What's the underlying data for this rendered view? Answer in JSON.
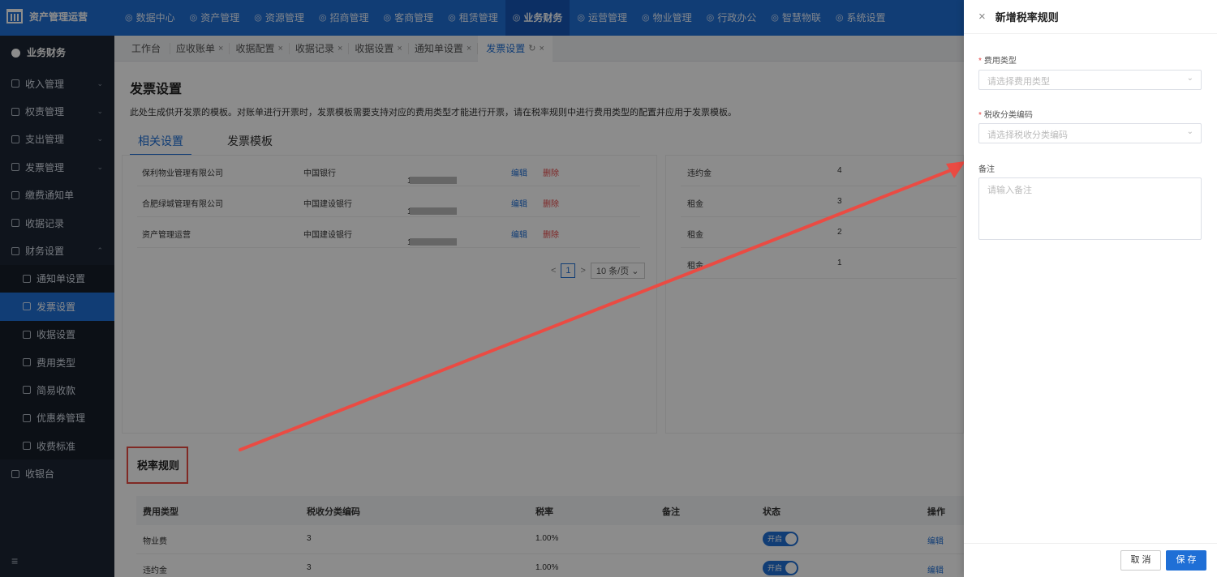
{
  "app": {
    "title": "资产管理运营"
  },
  "nav": [
    "数据中心",
    "资产管理",
    "资源管理",
    "招商管理",
    "客商管理",
    "租赁管理",
    "业务财务",
    "运营管理",
    "物业管理",
    "行政办公",
    "智慧物联",
    "系统设置"
  ],
  "nav_active": "业务财务",
  "sidebar": {
    "head": "业务财务",
    "items": [
      {
        "label": "收入管理",
        "expand": "⌄"
      },
      {
        "label": "权责管理",
        "expand": "⌄"
      },
      {
        "label": "支出管理",
        "expand": "⌄"
      },
      {
        "label": "发票管理",
        "expand": "⌄"
      },
      {
        "label": "缴费通知单",
        "expand": ""
      },
      {
        "label": "收据记录",
        "expand": ""
      },
      {
        "label": "财务设置",
        "expand": "⌃"
      }
    ],
    "sub_items": [
      "通知单设置",
      "发票设置",
      "收据设置",
      "费用类型",
      "简易收款",
      "优惠券管理",
      "收费标准"
    ],
    "last_item": "收银台",
    "menu_icon": "≡"
  },
  "tabs": [
    {
      "label": "工作台",
      "close": ""
    },
    {
      "label": "应收账单",
      "close": "×"
    },
    {
      "label": "收据配置",
      "close": "×"
    },
    {
      "label": "收据记录",
      "close": "×"
    },
    {
      "label": "收据设置",
      "close": "×"
    },
    {
      "label": "通知单设置",
      "close": "×"
    },
    {
      "label": "发票设置",
      "close": "×"
    }
  ],
  "page": {
    "title": "发票设置",
    "desc": "此处生成供开发票的模板。对账单进行开票时，发票模板需要支持对应的费用类型才能进行开票，请在税率规则中进行费用类型的配置并应用于发票模板。",
    "subtabs": [
      "相关设置",
      "发票模板"
    ]
  },
  "accounts": [
    {
      "company": "保利物业管理有限公司",
      "bank": "中国银行",
      "account": "1950",
      "edit": "编辑",
      "del": "删除"
    },
    {
      "company": "合肥绿城管理有限公司",
      "bank": "中国建设银行",
      "account": "1€",
      "edit": "编辑",
      "del": "删除"
    },
    {
      "company": "资产管理运营",
      "bank": "中国建设银行",
      "account": "18",
      "edit": "编辑",
      "del": "删除"
    }
  ],
  "pager": {
    "prev": "<",
    "page": "1",
    "next": ">",
    "size": "10 条/页 ⌄"
  },
  "right_rows": [
    {
      "type": "违约金",
      "n": "4"
    },
    {
      "type": "租金",
      "n": "3"
    },
    {
      "type": "租金",
      "n": "2"
    },
    {
      "type": "租金",
      "n": "1"
    }
  ],
  "tax": {
    "title": "税率规则",
    "headers": [
      "费用类型",
      "税收分类编码",
      "税率",
      "备注",
      "状态",
      "操作"
    ],
    "rows": [
      {
        "type": "物业费",
        "code": "3",
        "rate": "1.00%",
        "note": "",
        "status": "开启",
        "op": "编辑"
      },
      {
        "type": "违约金",
        "code": "3",
        "rate": "1.00%",
        "note": "",
        "status": "开启",
        "op": "编辑"
      }
    ]
  },
  "drawer": {
    "title": "新增税率规则",
    "close": "×",
    "fields": {
      "fee_type": {
        "label": "费用类型",
        "placeholder": "请选择费用类型",
        "required": "*"
      },
      "tax_code": {
        "label": "税收分类编码",
        "placeholder": "请选择税收分类编码",
        "required": "*"
      },
      "remark": {
        "label": "备注",
        "placeholder": "请输入备注"
      }
    },
    "cancel": "取 消",
    "save": "保 存"
  },
  "colors": {
    "primary": "#1f6fd6",
    "annotation": "#ea4b43",
    "sidebar": "#1d2633"
  }
}
